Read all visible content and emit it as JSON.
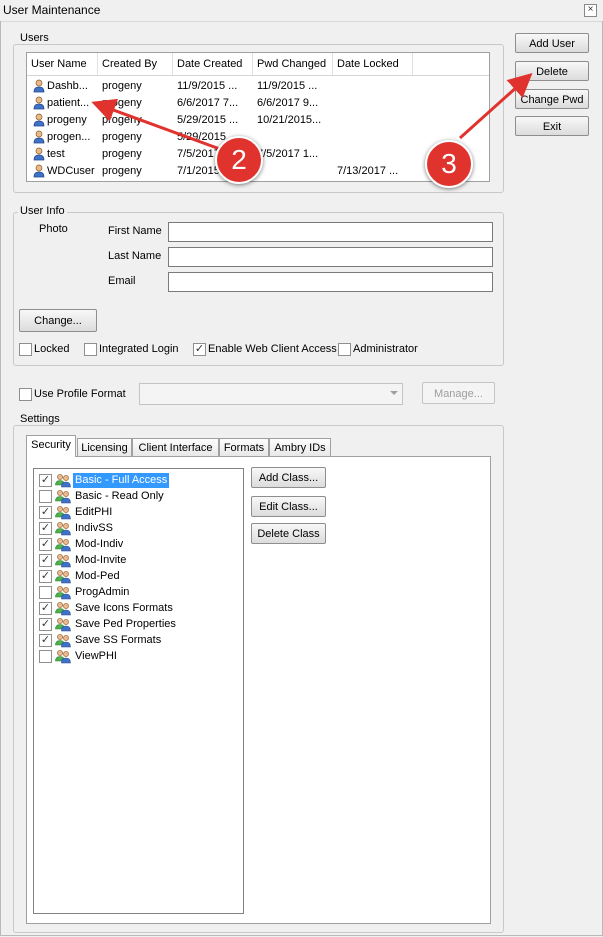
{
  "window": {
    "title": "User Maintenance",
    "close_glyph": "×"
  },
  "buttons": {
    "add_user": "Add User",
    "delete": "Delete",
    "change_pwd": "Change Pwd",
    "exit": "Exit",
    "change_photo": "Change...",
    "manage": "Manage...",
    "add_class": "Add Class...",
    "edit_class": "Edit Class...",
    "delete_class": "Delete Class"
  },
  "users": {
    "group_label": "Users",
    "columns": [
      "User Name",
      "Created By",
      "Date Created",
      "Pwd Changed",
      "Date Locked"
    ],
    "rows": [
      [
        "Dashb...",
        "progeny",
        "11/9/2015 ...",
        "11/9/2015 ...",
        ""
      ],
      [
        "patient...",
        "progeny",
        "6/6/2017 7...",
        "6/6/2017 9...",
        ""
      ],
      [
        "progeny",
        "progeny",
        "5/29/2015 ...",
        "10/21/2015...",
        ""
      ],
      [
        "progen...",
        "progeny",
        "5/29/2015",
        "",
        ""
      ],
      [
        "test",
        "progeny",
        "7/5/2017",
        "7/5/2017 1...",
        ""
      ],
      [
        "WDCuser",
        "progeny",
        "7/1/2015",
        "",
        "7/13/2017 ..."
      ]
    ]
  },
  "user_info": {
    "group_label": "User Info",
    "photo_label": "Photo",
    "first_name_label": "First Name",
    "last_name_label": "Last Name",
    "email_label": "Email",
    "first_name": "",
    "last_name": "",
    "email": ""
  },
  "options": {
    "locked": {
      "label": "Locked",
      "checked": false
    },
    "integrated_login": {
      "label": "Integrated Login",
      "checked": false
    },
    "web_client_access": {
      "label": "Enable Web Client Access",
      "checked": true
    },
    "administrator": {
      "label": "Administrator",
      "checked": false
    }
  },
  "profile": {
    "use_profile_format_label": "Use Profile Format",
    "checked": false,
    "selected": ""
  },
  "settings": {
    "group_label": "Settings",
    "tabs": [
      "Security",
      "Licensing",
      "Client Interface",
      "Formats",
      "Ambry IDs"
    ],
    "active_tab": "Security",
    "classes": [
      {
        "name": "Basic - Full Access",
        "checked": true,
        "selected": true
      },
      {
        "name": "Basic - Read Only",
        "checked": false,
        "selected": false
      },
      {
        "name": "EditPHI",
        "checked": true,
        "selected": false
      },
      {
        "name": "IndivSS",
        "checked": true,
        "selected": false
      },
      {
        "name": "Mod-Indiv",
        "checked": true,
        "selected": false
      },
      {
        "name": "Mod-Invite",
        "checked": true,
        "selected": false
      },
      {
        "name": "Mod-Ped",
        "checked": true,
        "selected": false
      },
      {
        "name": "ProgAdmin",
        "checked": false,
        "selected": false
      },
      {
        "name": "Save Icons Formats",
        "checked": true,
        "selected": false
      },
      {
        "name": "Save Ped Properties",
        "checked": true,
        "selected": false
      },
      {
        "name": "Save SS Formats",
        "checked": true,
        "selected": false
      },
      {
        "name": "ViewPHI",
        "checked": false,
        "selected": false
      }
    ]
  },
  "annotations": [
    {
      "number": "2"
    },
    {
      "number": "3"
    }
  ],
  "icons": {
    "user": "user-icon",
    "group": "user-group-icon",
    "check": "✓",
    "dropdown": "chevron-down-icon"
  },
  "colors": {
    "selection": "#3399ff",
    "annotation": "#e0332e"
  }
}
